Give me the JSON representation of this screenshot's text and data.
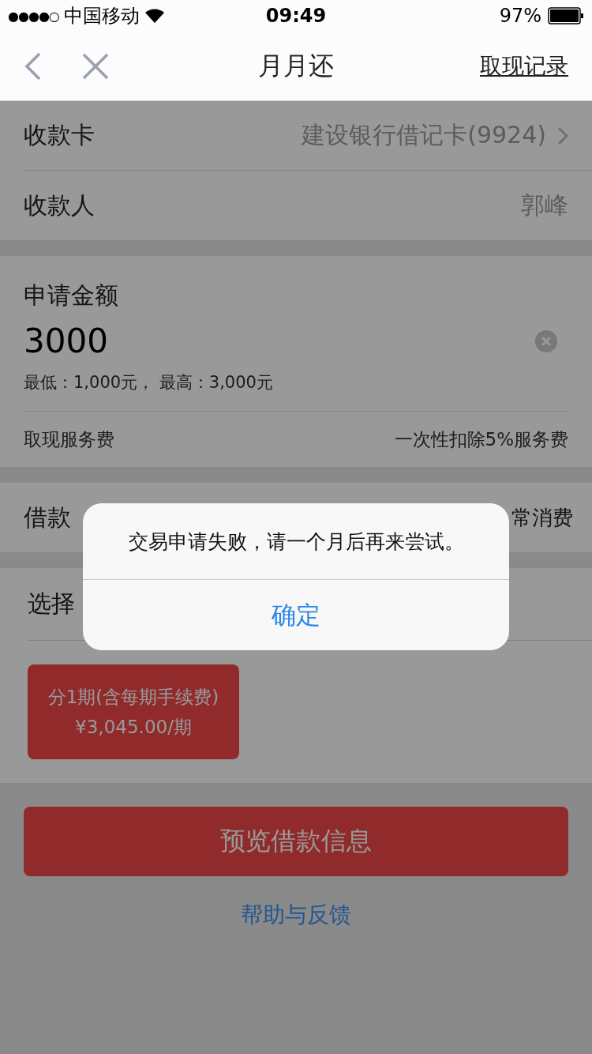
{
  "status_bar": {
    "signal_dots": [
      "●",
      "●",
      "●",
      "●",
      "○"
    ],
    "carrier": "中国移动",
    "time": "09:49",
    "battery": "97%"
  },
  "nav": {
    "title": "月月还",
    "action": "取现记录"
  },
  "card_rows": [
    {
      "label": "收款卡",
      "value": "建设银行借记卡(9924)",
      "chevron": true
    },
    {
      "label": "收款人",
      "value": "郭峰",
      "chevron": false
    }
  ],
  "amount": {
    "label": "申请金额",
    "value": "3000",
    "range": "最低：1,000元， 最高：3,000元",
    "fee_label": "取现服务费",
    "fee_value": "一次性扣除5%服务费"
  },
  "purpose": {
    "label": "借款",
    "value": "常消费"
  },
  "periods": {
    "title": "选择",
    "options": [
      {
        "line1": "分1期(含每期手续费)",
        "line2": "¥3,045.00/期",
        "selected": true
      }
    ]
  },
  "submit": "预览借款信息",
  "help_link": "帮助与反馈",
  "dialog": {
    "message": "交易申请失败，请一个月后再来尝试。",
    "button": "确定"
  }
}
